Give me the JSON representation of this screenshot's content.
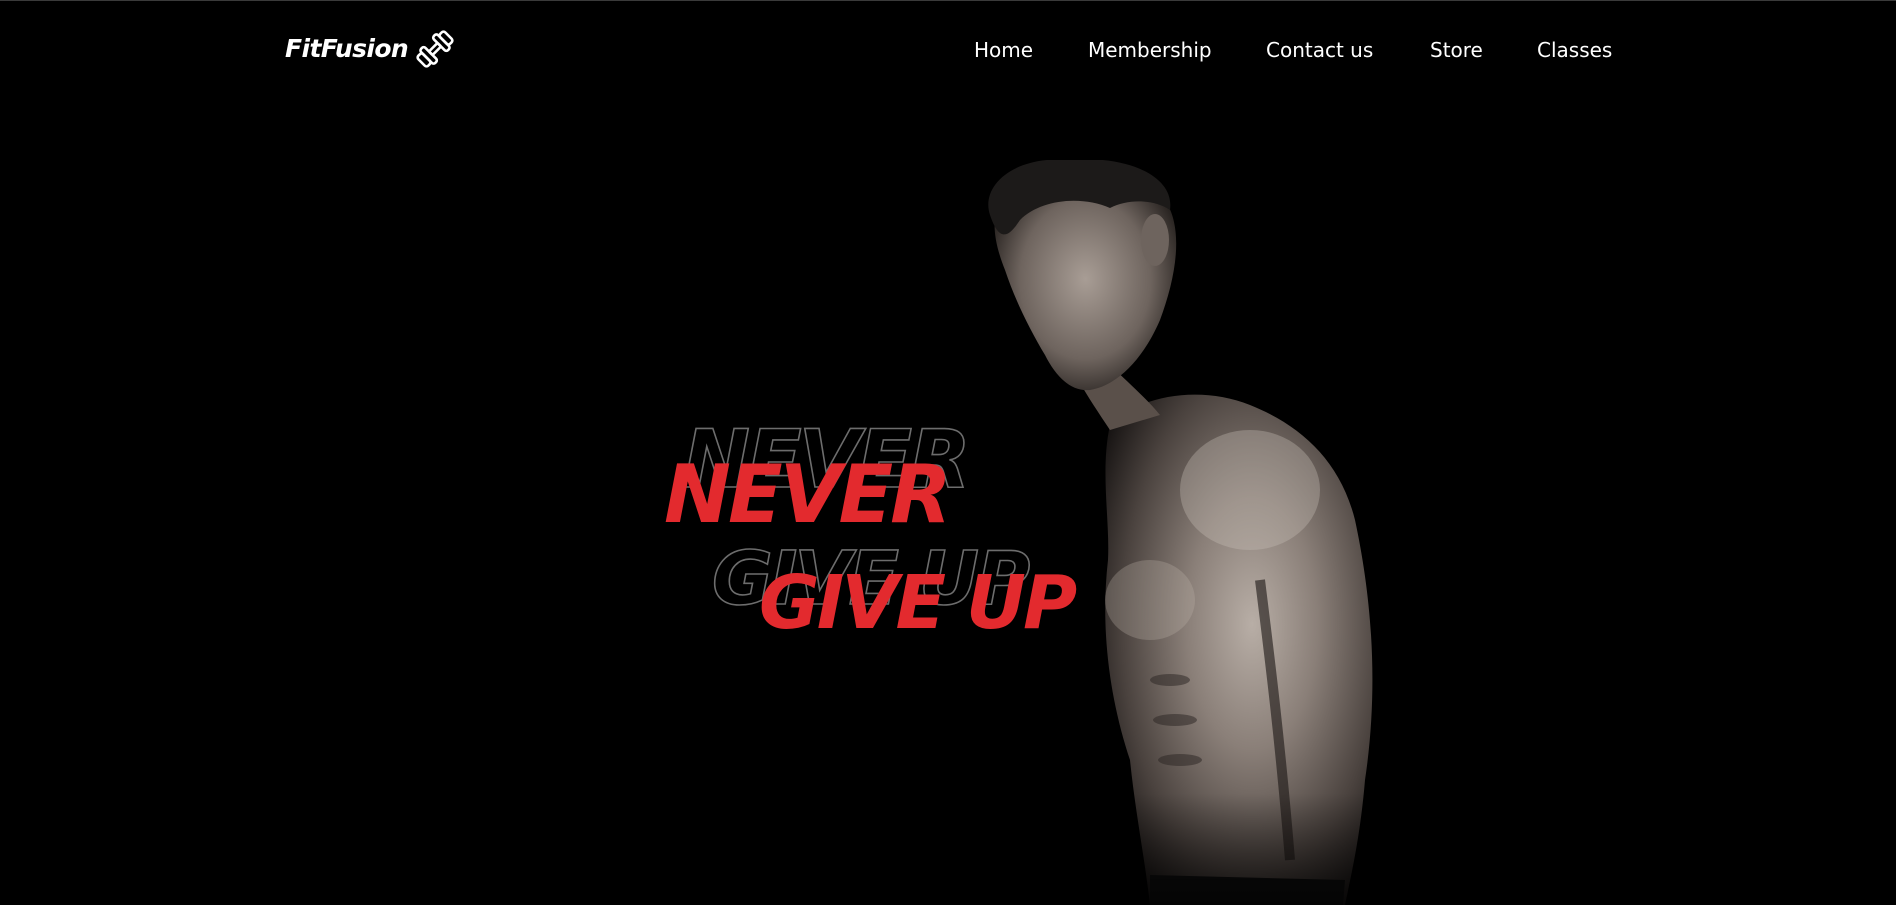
{
  "brand": {
    "name": "FitFusion",
    "icon": "dumbbell-icon"
  },
  "nav": {
    "items": [
      {
        "label": "Home"
      },
      {
        "label": "Membership"
      },
      {
        "label": "Contact us"
      },
      {
        "label": "Store"
      },
      {
        "label": "Classes"
      }
    ]
  },
  "hero": {
    "line1": "NEVER",
    "line2": "GIVE UP",
    "accent_color": "#e32a2e",
    "outline_color": "#6d6d6d",
    "image": "muscular-man-photo"
  },
  "colors": {
    "background": "#000000",
    "text": "#ffffff"
  }
}
